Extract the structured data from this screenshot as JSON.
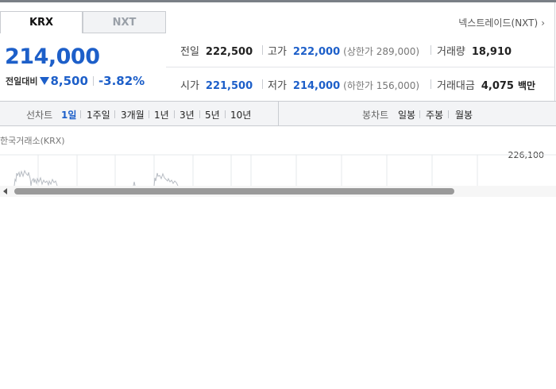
{
  "tabs": [
    {
      "label": "KRX",
      "active": true
    },
    {
      "label": "NXT",
      "active": false
    }
  ],
  "nxt_link": {
    "label": "넥스트레이드(NXT)",
    "icon": "chevron-right-icon"
  },
  "price": {
    "current": "214,000",
    "change_label": "전일대비",
    "change_value": "8,500",
    "change_rate": "-3.82%",
    "direction_icon": "down-triangle-icon",
    "color": "#1d5fc9"
  },
  "stats": {
    "prev_close": {
      "label": "전일",
      "value": "222,500"
    },
    "high": {
      "label": "고가",
      "value": "222,000",
      "sub": "(상한가 289,000)"
    },
    "volume": {
      "label": "거래량",
      "value": "18,910"
    },
    "open": {
      "label": "시가",
      "value": "221,500"
    },
    "low": {
      "label": "저가",
      "value": "214,000",
      "sub": "(하한가 156,000)"
    },
    "amount": {
      "label": "거래대금",
      "value": "4,075",
      "unit": "백만"
    }
  },
  "line_chart": {
    "label": "선차트",
    "periods": [
      {
        "label": "1일",
        "active": true
      },
      {
        "label": "1주일",
        "active": false
      },
      {
        "label": "3개월",
        "active": false
      },
      {
        "label": "1년",
        "active": false
      },
      {
        "label": "3년",
        "active": false
      },
      {
        "label": "5년",
        "active": false
      },
      {
        "label": "10년",
        "active": false
      }
    ]
  },
  "candle_chart": {
    "label": "봉차트",
    "periods": [
      {
        "label": "일봉"
      },
      {
        "label": "주봉"
      },
      {
        "label": "월봉"
      }
    ]
  },
  "chart": {
    "title": "한국거래소(KRX)",
    "y_tick": "226,100"
  },
  "scrollbar": {
    "thumb_fraction": 0.79
  }
}
